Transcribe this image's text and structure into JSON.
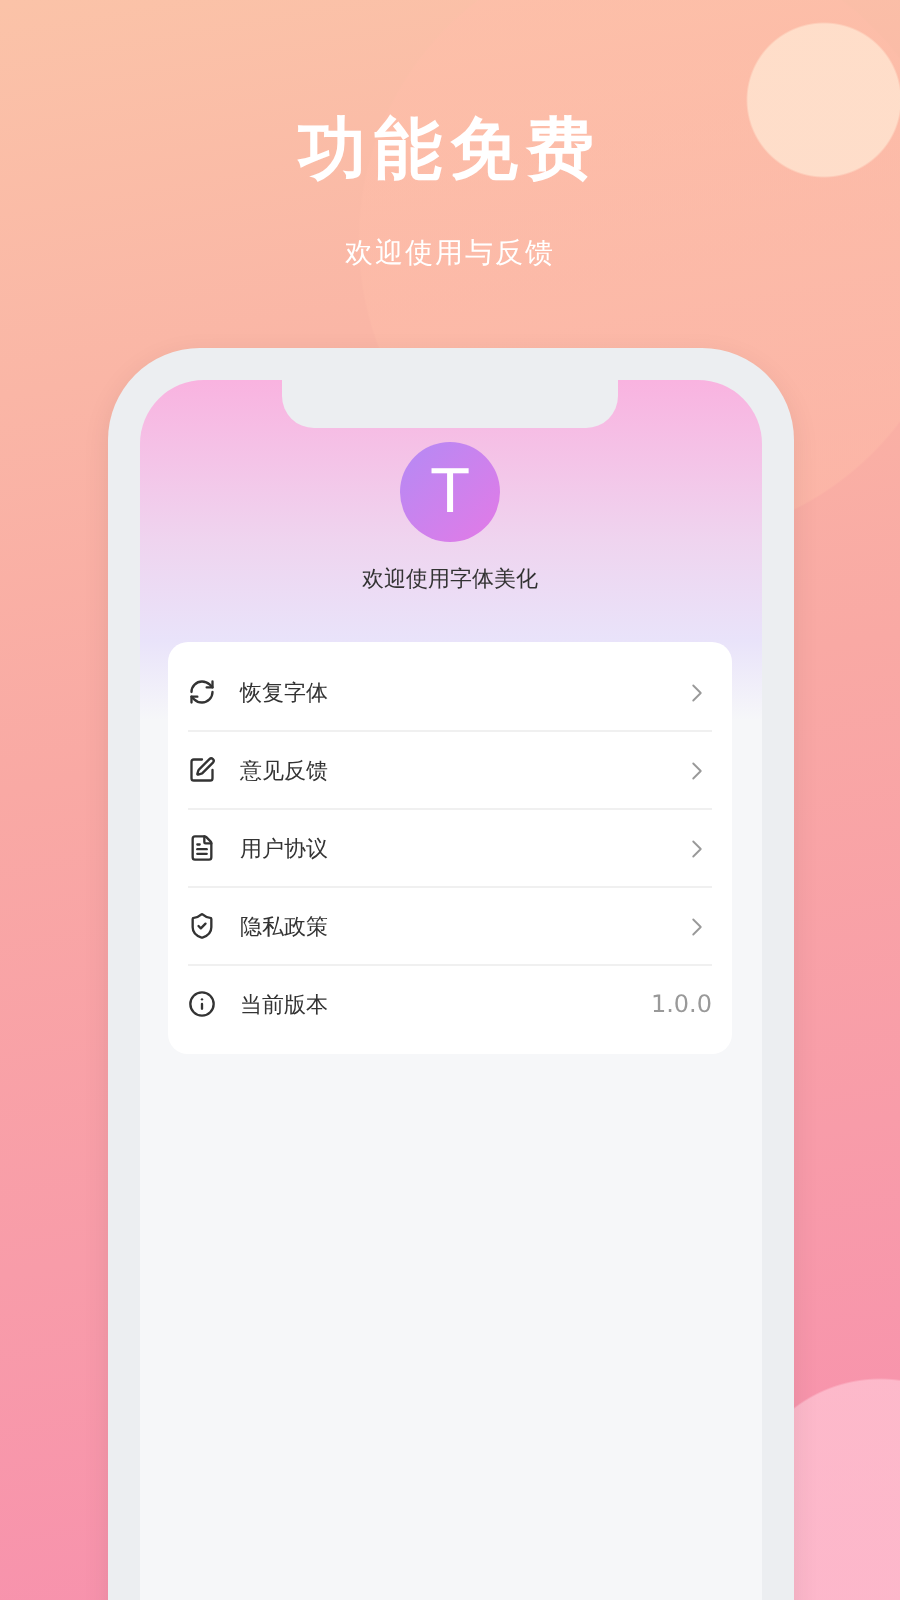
{
  "headline": "功能免费",
  "subtitle": "欢迎使用与反馈",
  "app": {
    "logo_letter": "T",
    "welcome": "欢迎使用字体美化"
  },
  "menu": [
    {
      "kind": "link",
      "label": "恢复字体"
    },
    {
      "kind": "link",
      "label": "意见反馈"
    },
    {
      "kind": "link",
      "label": "用户协议"
    },
    {
      "kind": "link",
      "label": "隐私政策"
    },
    {
      "kind": "value",
      "label": "当前版本",
      "value": "1.0.0"
    }
  ]
}
